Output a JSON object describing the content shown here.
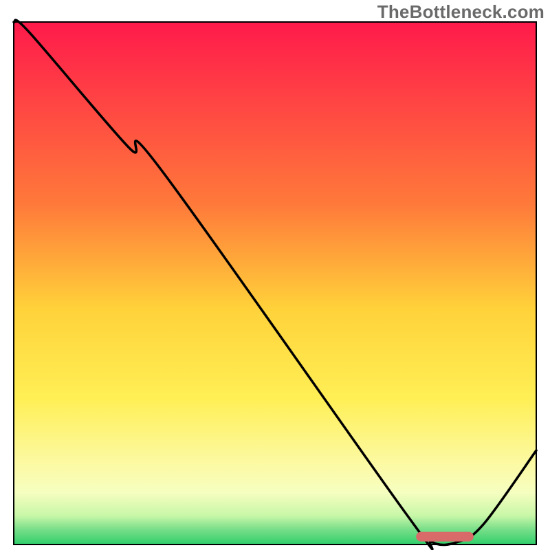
{
  "watermark": "TheBottleneck.com",
  "chart_data": {
    "type": "line",
    "title": "",
    "xlabel": "",
    "ylabel": "",
    "xlim": [
      0,
      100
    ],
    "ylim": [
      0,
      100
    ],
    "x": [
      0,
      3,
      22,
      28,
      75,
      80,
      85,
      90,
      100
    ],
    "values": [
      100,
      98,
      76,
      72,
      6,
      0.5,
      0.5,
      4,
      18
    ],
    "optimal_marker": {
      "x_start": 77,
      "x_end": 88,
      "y": 1.5
    },
    "gradient_stops": [
      {
        "offset": 0,
        "color": "#ff1a4b"
      },
      {
        "offset": 0.35,
        "color": "#ff7a3a"
      },
      {
        "offset": 0.55,
        "color": "#ffd23a"
      },
      {
        "offset": 0.72,
        "color": "#ffef55"
      },
      {
        "offset": 0.84,
        "color": "#fcf9a0"
      },
      {
        "offset": 0.9,
        "color": "#f6fec0"
      },
      {
        "offset": 0.945,
        "color": "#c8f7a8"
      },
      {
        "offset": 0.97,
        "color": "#7bdf8a"
      },
      {
        "offset": 1.0,
        "color": "#2fcf6b"
      }
    ],
    "border_color": "#000000",
    "border_width": 2,
    "curve_color": "#000000",
    "curve_width": 3.5,
    "marker_color": "#d86a6a",
    "marker_height": 14
  }
}
